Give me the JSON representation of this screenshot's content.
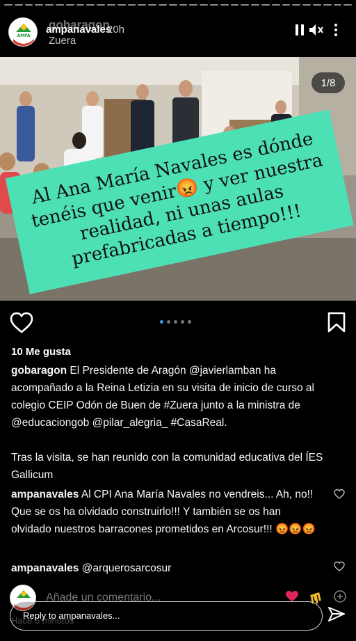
{
  "story": {
    "username": "ampanavales",
    "time": "20h",
    "ghost_handle": "gobaragon",
    "ghost_location": "Zuera",
    "avatar_text": "AMPA NAVALES"
  },
  "post": {
    "image_counter": "1/8",
    "sticker_text": "Al Ana María Navales es dónde tenéis que venir😡 y ver nuestra realidad, ni unas aulas prefabricadas a tiempo!!!",
    "carousel_dots": 5,
    "carousel_active": 0,
    "likes": "10 Me gusta",
    "caption_user": "gobaragon",
    "caption_text": " El Presidente de Aragón @javierlamban ha acompañado a la Reina Letizia en su visita de inicio de curso al colegio CEIP Odón de Buen de #Zuera junto a la ministra de @educaciongob @pilar_alegria_ #CasaReal.",
    "caption_text2": "Tras la visita, se han reunido con la comunidad educativa del ÍES Gallicum",
    "comments": [
      {
        "user": "ampanavales",
        "text": " Al CPI Ana María Navales no vendreis... Ah, no!! Que se os ha olvidado construirlo!!! Y también se os han olvidado nuestros barracones prometidos en Arcosur!!! 😡😡😡"
      },
      {
        "user": "ampanavales",
        "text": " @arquerosarcosur"
      }
    ],
    "add_comment_placeholder": "Añade un comentario...",
    "time_ago": "Hace 5 minutos"
  },
  "reply": {
    "placeholder": "Reply to ampanavales..."
  },
  "colors": {
    "sticker_bg": "#4ee0b5",
    "active_dot": "#3897f0",
    "avatar_green": "#2c9a3c",
    "avatar_red": "#d83a26"
  }
}
